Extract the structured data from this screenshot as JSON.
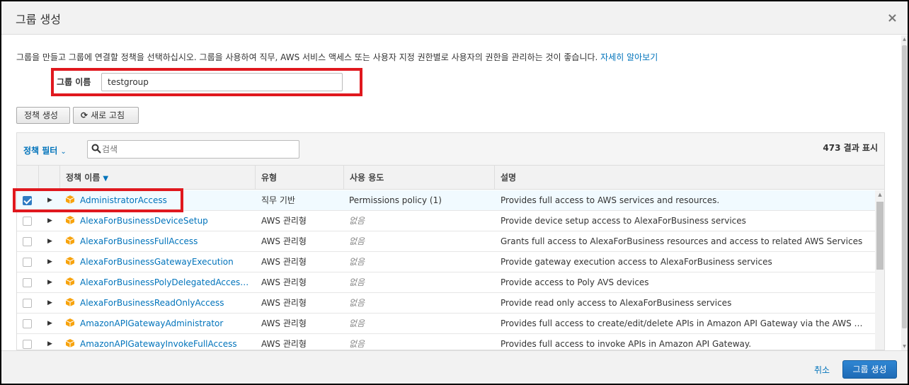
{
  "dialog": {
    "title": "그룹 생성",
    "close_icon": "×"
  },
  "description": {
    "text": "그룹을 만들고 그룹에 연결할 정책을 선택하십시오. 그룹을 사용하여 직무, AWS 서비스 액세스 또는 사용자 지정 권한별로 사용자의 권한을 관리하는 것이 좋습니다.",
    "link": "자세히 알아보기"
  },
  "group_name": {
    "label": "그룹 이름",
    "value": "testgroup"
  },
  "actions": {
    "create_policy": "정책 생성",
    "refresh": "새로 고침",
    "refresh_icon": "⟳"
  },
  "policy_table": {
    "filter_label": "정책 필터",
    "filter_chevron": "⌄",
    "search_placeholder": "검색",
    "results": "473 결과 표시",
    "columns": {
      "name": "정책 이름",
      "type": "유형",
      "usage": "사용 용도",
      "description": "설명"
    },
    "sort_icon": "▼",
    "rows": [
      {
        "checked": true,
        "name": "AdministratorAccess",
        "type": "직무 기반",
        "usage": "Permissions policy (1)",
        "usage_none": false,
        "description": "Provides full access to AWS services and resources."
      },
      {
        "checked": false,
        "name": "AlexaForBusinessDeviceSetup",
        "type": "AWS 관리형",
        "usage": "없음",
        "usage_none": true,
        "description": "Provide device setup access to AlexaForBusiness services"
      },
      {
        "checked": false,
        "name": "AlexaForBusinessFullAccess",
        "type": "AWS 관리형",
        "usage": "없음",
        "usage_none": true,
        "description": "Grants full access to AlexaForBusiness resources and access to related AWS Services"
      },
      {
        "checked": false,
        "name": "AlexaForBusinessGatewayExecution",
        "type": "AWS 관리형",
        "usage": "없음",
        "usage_none": true,
        "description": "Provide gateway execution access to AlexaForBusiness services"
      },
      {
        "checked": false,
        "name": "AlexaForBusinessPolyDelegatedAccessP...",
        "type": "AWS 관리형",
        "usage": "없음",
        "usage_none": true,
        "description": "Provide access to Poly AVS devices"
      },
      {
        "checked": false,
        "name": "AlexaForBusinessReadOnlyAccess",
        "type": "AWS 관리형",
        "usage": "없음",
        "usage_none": true,
        "description": "Provide read only access to AlexaForBusiness services"
      },
      {
        "checked": false,
        "name": "AmazonAPIGatewayAdministrator",
        "type": "AWS 관리형",
        "usage": "없음",
        "usage_none": true,
        "description": "Provides full access to create/edit/delete APIs in Amazon API Gateway via the AWS Manageme..."
      },
      {
        "checked": false,
        "name": "AmazonAPIGatewayInvokeFullAccess",
        "type": "AWS 관리형",
        "usage": "없음",
        "usage_none": true,
        "description": "Provides full access to invoke APIs in Amazon API Gateway."
      }
    ]
  },
  "footer": {
    "cancel": "취소",
    "submit": "그룹 생성"
  },
  "colors": {
    "link": "#0073bb",
    "primary_button": "#2f86d3",
    "highlight_border": "#e0181e",
    "policy_icon": "#f7a30d",
    "selected_row": "#f1faff"
  }
}
